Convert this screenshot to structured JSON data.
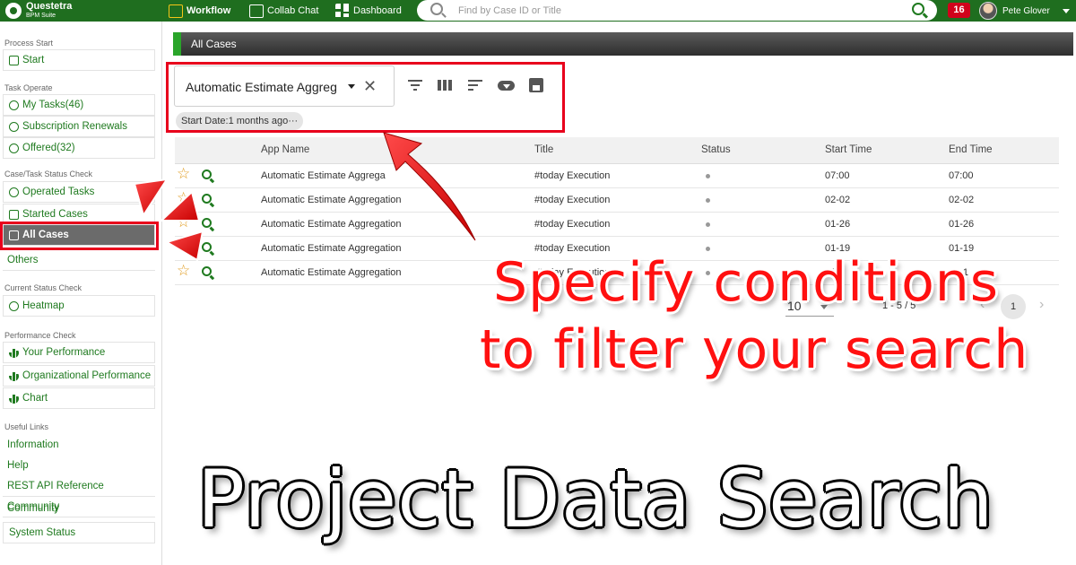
{
  "header": {
    "logo_name": "Questetra",
    "logo_sub": "BPM Suite",
    "nav": [
      {
        "label": "Workflow",
        "icon": "workflow-icon"
      },
      {
        "label": "Collab Chat",
        "icon": "chat-icon"
      },
      {
        "label": "Dashboard",
        "icon": "dashboard-icon"
      }
    ],
    "search_placeholder": "Find by Case ID or Title",
    "notification_count": "16",
    "user_name": "Pete Glover"
  },
  "sidebar": {
    "sections": [
      {
        "label": "Process Start",
        "items": [
          {
            "label": "Start",
            "icon": "start-icon"
          }
        ]
      },
      {
        "label": "Task Operate",
        "items": [
          {
            "label": "My Tasks(46)",
            "icon": "play-circle-icon"
          },
          {
            "label": "Subscription Renewals",
            "icon": "play-circle-icon"
          },
          {
            "label": "Offered(32)",
            "icon": "download-circle-icon"
          }
        ]
      },
      {
        "label": "Case/Task Status Check",
        "items": [
          {
            "label": "Operated Tasks",
            "icon": "nodes-icon"
          },
          {
            "label": "Started Cases",
            "icon": "copy-icon"
          },
          {
            "label": "All Cases",
            "icon": "copy-icon",
            "active": true
          },
          {
            "label": "Others",
            "icon": ""
          }
        ]
      },
      {
        "label": "Current Status Check",
        "items": [
          {
            "label": "Heatmap",
            "icon": "check-circle-icon"
          }
        ]
      },
      {
        "label": "Performance Check",
        "items": [
          {
            "label": "Your Performance",
            "icon": "bar-chart-icon"
          },
          {
            "label": "Organizational Performance",
            "icon": "bar-chart-icon"
          },
          {
            "label": "Chart",
            "icon": "bar-chart-icon"
          }
        ]
      },
      {
        "label": "Useful Links",
        "items": [
          {
            "label": "Information"
          },
          {
            "label": "Help"
          },
          {
            "label": "REST API Reference"
          },
          {
            "label": "Community"
          },
          {
            "label": "Community"
          },
          {
            "label": "System Status"
          }
        ]
      }
    ]
  },
  "main": {
    "title": "All Cases",
    "app_select_value": "Automatic Estimate Aggreg",
    "filter_chip": "Start Date:1 months ago···",
    "columns": [
      "App Name",
      "Title",
      "Status",
      "Start Time",
      "End Time"
    ],
    "rows": [
      {
        "app": "Automatic Estimate Aggrega",
        "title": "#today Execution",
        "status": "●",
        "start": "07:00",
        "end": "07:00"
      },
      {
        "app": "Automatic Estimate Aggregation",
        "title": "#today Execution",
        "status": "●",
        "start": "02-02",
        "end": "02-02"
      },
      {
        "app": "Automatic Estimate Aggregation",
        "title": "#today Execution",
        "status": "●",
        "start": "01-26",
        "end": "01-26"
      },
      {
        "app": "Automatic Estimate Aggregation",
        "title": "#today Execution",
        "status": "●",
        "start": "01-19",
        "end": "01-19"
      },
      {
        "app": "Automatic Estimate Aggregation",
        "title": "#today Execution",
        "status": "●",
        "start": "01-1",
        "end": "01-1"
      }
    ],
    "pager": {
      "page_size": "10",
      "range": "1 - 5 / 5",
      "current_page": "1"
    }
  },
  "overlay": {
    "callout_line1": "Specify conditions",
    "callout_line2": "to filter your search",
    "banner": "Project Data Search",
    "highlight_color": "#e8001c"
  }
}
